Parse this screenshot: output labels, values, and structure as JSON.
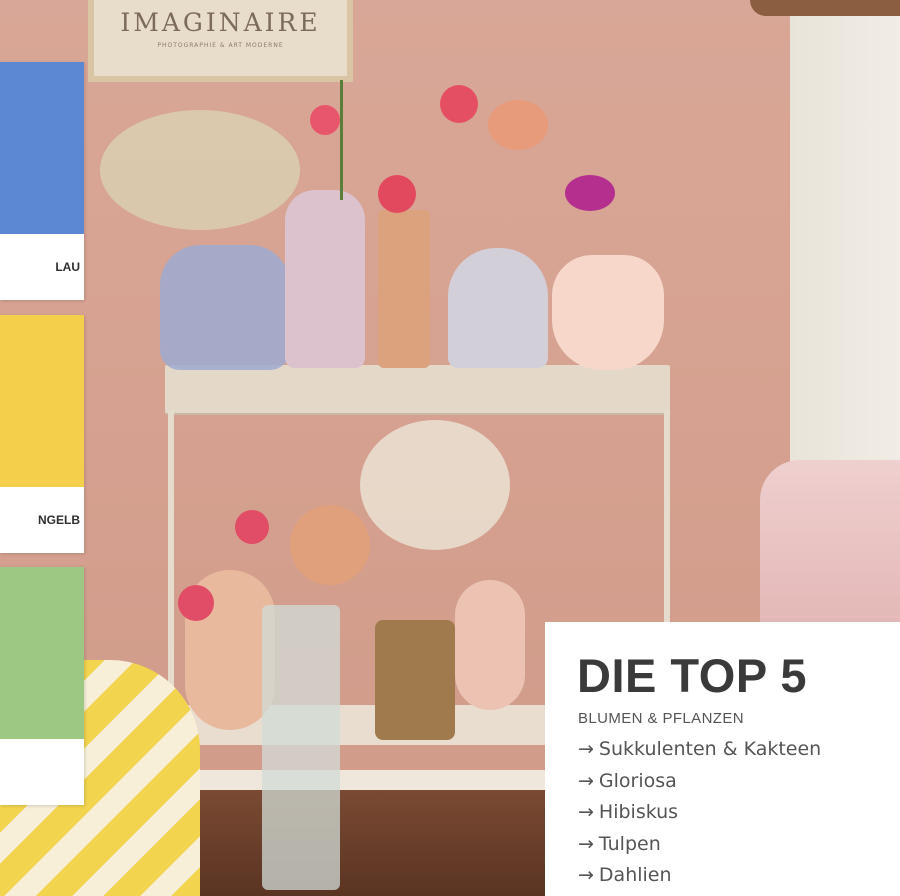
{
  "poster": {
    "title": "IMAGINAIRE",
    "subtitle": "PHOTOGRAPHIE & ART MODERNE"
  },
  "swatches": [
    {
      "label": "LAU",
      "color": "#5b87d3"
    },
    {
      "label": "NGELB",
      "color": "#f4cf4b"
    },
    {
      "label": "",
      "color": "#9cc883"
    }
  ],
  "card": {
    "title": "DIE TOP 5",
    "subtitle": "BLUMEN & PFLANZEN",
    "arrow": "→",
    "items": [
      "Sukkulenten & Kakteen",
      "Gloriosa",
      "Hibiskus",
      "Tulpen",
      "Dahlien"
    ]
  },
  "colors": {
    "wall": "#d8a595",
    "card_background": "#ffffff",
    "text": "#3a3a3a"
  }
}
